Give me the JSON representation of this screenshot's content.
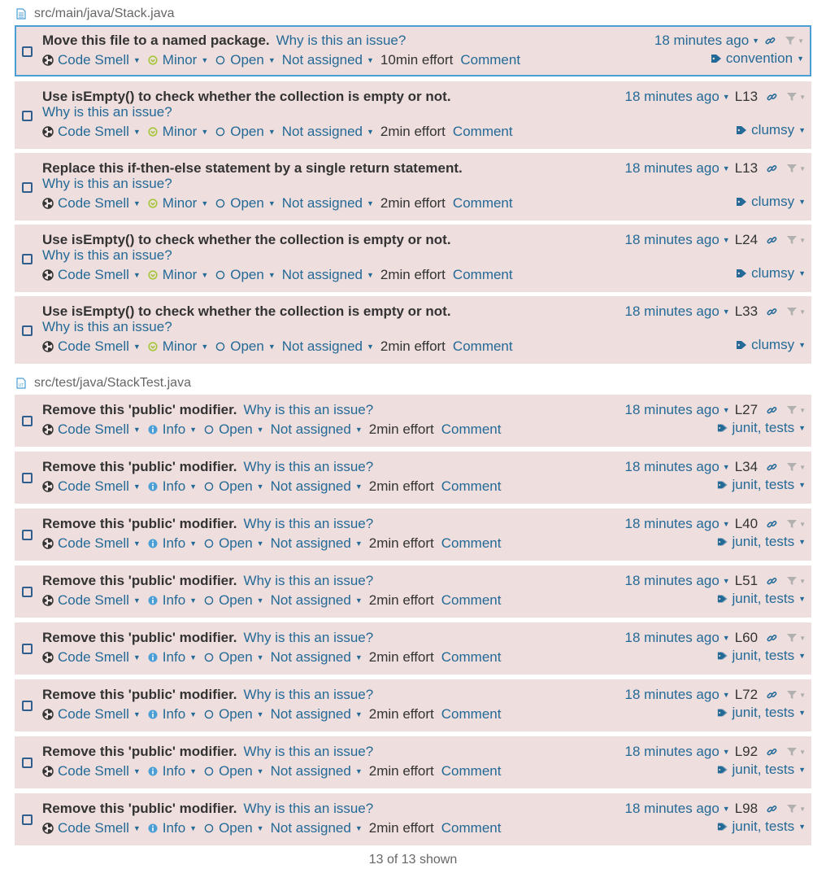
{
  "files": [
    {
      "path": "src/main/java/Stack.java",
      "issues": [
        {
          "message": "Move this file to a named package.",
          "why": "Why is this an issue?",
          "type": "Code Smell",
          "severity": "Minor",
          "status": "Open",
          "assignee": "Not assigned",
          "effort": "10min effort",
          "comment": "Comment",
          "date": "18 minutes ago",
          "line": "",
          "tags": "convention"
        },
        {
          "message": "Use isEmpty() to check whether the collection is empty or not.",
          "why": "Why is this an issue?",
          "type": "Code Smell",
          "severity": "Minor",
          "status": "Open",
          "assignee": "Not assigned",
          "effort": "2min effort",
          "comment": "Comment",
          "date": "18 minutes ago",
          "line": "L13",
          "tags": "clumsy"
        },
        {
          "message": "Replace this if-then-else statement by a single return statement.",
          "why": "Why is this an issue?",
          "type": "Code Smell",
          "severity": "Minor",
          "status": "Open",
          "assignee": "Not assigned",
          "effort": "2min effort",
          "comment": "Comment",
          "date": "18 minutes ago",
          "line": "L13",
          "tags": "clumsy"
        },
        {
          "message": "Use isEmpty() to check whether the collection is empty or not.",
          "why": "Why is this an issue?",
          "type": "Code Smell",
          "severity": "Minor",
          "status": "Open",
          "assignee": "Not assigned",
          "effort": "2min effort",
          "comment": "Comment",
          "date": "18 minutes ago",
          "line": "L24",
          "tags": "clumsy"
        },
        {
          "message": "Use isEmpty() to check whether the collection is empty or not.",
          "why": "Why is this an issue?",
          "type": "Code Smell",
          "severity": "Minor",
          "status": "Open",
          "assignee": "Not assigned",
          "effort": "2min effort",
          "comment": "Comment",
          "date": "18 minutes ago",
          "line": "L33",
          "tags": "clumsy"
        }
      ]
    },
    {
      "path": "src/test/java/StackTest.java",
      "issues": [
        {
          "message": "Remove this 'public' modifier.",
          "why": "Why is this an issue?",
          "type": "Code Smell",
          "severity": "Info",
          "status": "Open",
          "assignee": "Not assigned",
          "effort": "2min effort",
          "comment": "Comment",
          "date": "18 minutes ago",
          "line": "L27",
          "tags": "junit, tests"
        },
        {
          "message": "Remove this 'public' modifier.",
          "why": "Why is this an issue?",
          "type": "Code Smell",
          "severity": "Info",
          "status": "Open",
          "assignee": "Not assigned",
          "effort": "2min effort",
          "comment": "Comment",
          "date": "18 minutes ago",
          "line": "L34",
          "tags": "junit, tests"
        },
        {
          "message": "Remove this 'public' modifier.",
          "why": "Why is this an issue?",
          "type": "Code Smell",
          "severity": "Info",
          "status": "Open",
          "assignee": "Not assigned",
          "effort": "2min effort",
          "comment": "Comment",
          "date": "18 minutes ago",
          "line": "L40",
          "tags": "junit, tests"
        },
        {
          "message": "Remove this 'public' modifier.",
          "why": "Why is this an issue?",
          "type": "Code Smell",
          "severity": "Info",
          "status": "Open",
          "assignee": "Not assigned",
          "effort": "2min effort",
          "comment": "Comment",
          "date": "18 minutes ago",
          "line": "L51",
          "tags": "junit, tests"
        },
        {
          "message": "Remove this 'public' modifier.",
          "why": "Why is this an issue?",
          "type": "Code Smell",
          "severity": "Info",
          "status": "Open",
          "assignee": "Not assigned",
          "effort": "2min effort",
          "comment": "Comment",
          "date": "18 minutes ago",
          "line": "L60",
          "tags": "junit, tests"
        },
        {
          "message": "Remove this 'public' modifier.",
          "why": "Why is this an issue?",
          "type": "Code Smell",
          "severity": "Info",
          "status": "Open",
          "assignee": "Not assigned",
          "effort": "2min effort",
          "comment": "Comment",
          "date": "18 minutes ago",
          "line": "L72",
          "tags": "junit, tests"
        },
        {
          "message": "Remove this 'public' modifier.",
          "why": "Why is this an issue?",
          "type": "Code Smell",
          "severity": "Info",
          "status": "Open",
          "assignee": "Not assigned",
          "effort": "2min effort",
          "comment": "Comment",
          "date": "18 minutes ago",
          "line": "L92",
          "tags": "junit, tests"
        },
        {
          "message": "Remove this 'public' modifier.",
          "why": "Why is this an issue?",
          "type": "Code Smell",
          "severity": "Info",
          "status": "Open",
          "assignee": "Not assigned",
          "effort": "2min effort",
          "comment": "Comment",
          "date": "18 minutes ago",
          "line": "L98",
          "tags": "junit, tests"
        }
      ]
    }
  ],
  "footer": {
    "shown": "13 of 13 shown"
  },
  "colors": {
    "issue_bg": "#efdede",
    "link": "#236a97",
    "selected_border": "#4b9fd5",
    "minor_icon": "#a4c639",
    "info_icon": "#4b9fd5"
  }
}
